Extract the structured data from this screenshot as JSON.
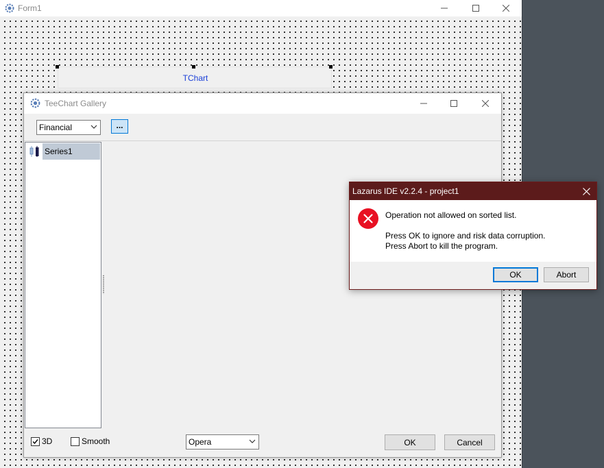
{
  "form1": {
    "title": "Form1",
    "chart_component_label": "TChart"
  },
  "gallery": {
    "title": "TeeChart Gallery",
    "category_selected": "Financial",
    "browse_button_label": "...",
    "series": [
      {
        "label": "Series1",
        "icon": "candle-series-icon"
      }
    ],
    "checkbox_3d": {
      "label": "3D",
      "checked": true
    },
    "checkbox_smooth": {
      "label": "Smooth",
      "checked": false
    },
    "theme_selected": "Opera",
    "ok_label": "OK",
    "cancel_label": "Cancel"
  },
  "error_dialog": {
    "title": "Lazarus IDE v2.2.4 - project1",
    "message": "Operation not allowed on sorted list.",
    "detail_line1": "Press OK to ignore and risk data corruption.",
    "detail_line2": "Press Abort to kill the program.",
    "ok_label": "OK",
    "abort_label": "Abort",
    "icon": "error-icon"
  },
  "colors": {
    "error_titlebar": "#5c1b1b",
    "error_icon": "#e81123",
    "selection": "#c0cad6",
    "focus_accent": "#0078d7",
    "tchart_label": "#1a3fd8",
    "desktop": "#4b535b"
  }
}
